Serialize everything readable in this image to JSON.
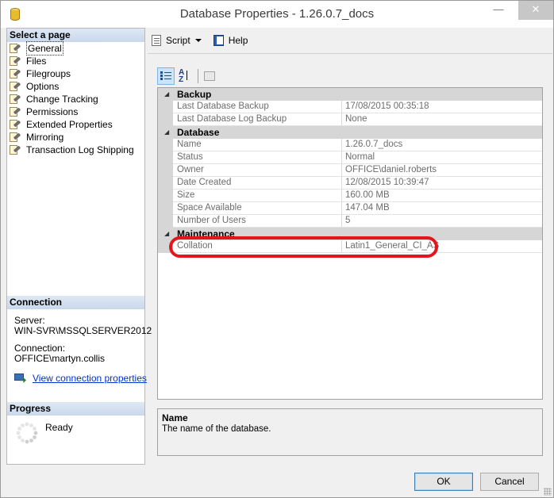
{
  "window": {
    "title": "Database Properties - 1.26.0.7_docs",
    "close_glyph": "✕",
    "minimize_glyph": "—"
  },
  "left_pane": {
    "select_page_header": "Select a page",
    "pages": [
      {
        "label": "General",
        "icon": "wrench-page-icon",
        "selected": true
      },
      {
        "label": "Files",
        "icon": "wrench-page-icon"
      },
      {
        "label": "Filegroups",
        "icon": "wrench-page-icon"
      },
      {
        "label": "Options",
        "icon": "wrench-page-icon"
      },
      {
        "label": "Change Tracking",
        "icon": "wrench-page-icon"
      },
      {
        "label": "Permissions",
        "icon": "wrench-page-icon"
      },
      {
        "label": "Extended Properties",
        "icon": "wrench-page-icon"
      },
      {
        "label": "Mirroring",
        "icon": "wrench-page-icon"
      },
      {
        "label": "Transaction Log Shipping",
        "icon": "wrench-page-icon"
      }
    ],
    "connection": {
      "header": "Connection",
      "server_label": "Server:",
      "server_value": "WIN-SVR\\MSSQLSERVER2012",
      "connection_label": "Connection:",
      "connection_value": "OFFICE\\martyn.collis",
      "view_link": "View connection properties"
    },
    "progress": {
      "header": "Progress",
      "status": "Ready"
    }
  },
  "toolbar": {
    "script_label": "Script",
    "help_label": "Help"
  },
  "property_grid": {
    "categories": [
      {
        "name": "Backup",
        "properties": [
          {
            "name": "Last Database Backup",
            "value": "17/08/2015 00:35:18"
          },
          {
            "name": "Last Database Log Backup",
            "value": "None"
          }
        ]
      },
      {
        "name": "Database",
        "properties": [
          {
            "name": "Name",
            "value": "1.26.0.7_docs"
          },
          {
            "name": "Status",
            "value": "Normal"
          },
          {
            "name": "Owner",
            "value": "OFFICE\\daniel.roberts"
          },
          {
            "name": "Date Created",
            "value": "12/08/2015 10:39:47"
          },
          {
            "name": "Size",
            "value": "160.00 MB"
          },
          {
            "name": "Space Available",
            "value": "147.04 MB"
          },
          {
            "name": "Number of Users",
            "value": "5"
          }
        ]
      },
      {
        "name": "Maintenance",
        "properties": [
          {
            "name": "Collation",
            "value": "Latin1_General_CI_AS",
            "highlighted": true
          }
        ]
      }
    ],
    "highlight_color": "#e2171c"
  },
  "description": {
    "title": "Name",
    "text": "The name of the database."
  },
  "buttons": {
    "ok": "OK",
    "cancel": "Cancel"
  }
}
